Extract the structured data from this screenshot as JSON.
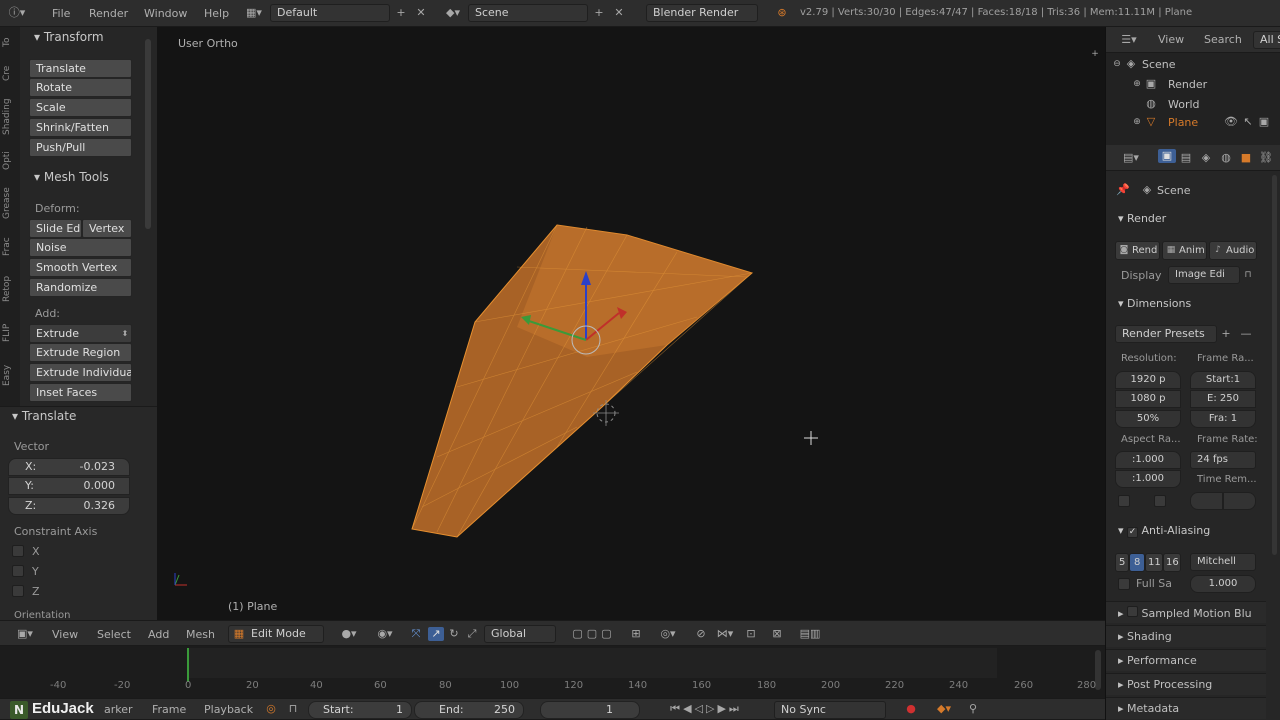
{
  "topbar": {
    "menus": [
      "File",
      "Render",
      "Window",
      "Help"
    ],
    "screen_layout": "Default",
    "scene": "Scene",
    "render_engine": "Blender Render",
    "stats": "v2.79 | Verts:30/30 | Edges:47/47 | Faces:18/18 | Tris:36 | Mem:11.11M | Plane"
  },
  "tool_shelf": {
    "vertical_tabs": [
      "To",
      "Cre",
      "Shading",
      "Opti",
      "Grease",
      "Frac",
      "Retop",
      "FLIP",
      "Easy"
    ],
    "transform": {
      "title": "Transform",
      "buttons": [
        "Translate",
        "Rotate",
        "Scale",
        "Shrink/Fatten",
        "Push/Pull"
      ]
    },
    "mesh_tools": {
      "title": "Mesh Tools",
      "deform_label": "Deform:",
      "slide_edge": "Slide Ed",
      "vertex": "Vertex",
      "buttons": [
        "Noise",
        "Smooth Vertex",
        "Randomize"
      ],
      "add_label": "Add:",
      "extrude": "Extrude",
      "add_buttons": [
        "Extrude Region",
        "Extrude Individual",
        "Inset Faces"
      ]
    },
    "operator": {
      "title": "Translate",
      "vector_label": "Vector",
      "x_label": "X:",
      "x_value": "-0.023",
      "y_label": "Y:",
      "y_value": "0.000",
      "z_label": "Z:",
      "z_value": "0.326",
      "constraint_label": "Constraint Axis",
      "axes": [
        "X",
        "Y",
        "Z"
      ],
      "orientation_label": "Orientation"
    }
  },
  "viewport": {
    "view_name": "User Ortho",
    "object_label": "(1) Plane",
    "header": {
      "view": "View",
      "select": "Select",
      "add": "Add",
      "mesh": "Mesh",
      "mode": "Edit Mode",
      "orientation": "Global"
    }
  },
  "timeline": {
    "ticks": [
      "-40",
      "-20",
      "0",
      "20",
      "40",
      "60",
      "80",
      "100",
      "120",
      "140",
      "160",
      "180",
      "200",
      "220",
      "240",
      "260",
      "280"
    ],
    "menus": [
      "arker",
      "Frame",
      "Playback"
    ],
    "start_label": "Start:",
    "start_value": "1",
    "end_label": "End:",
    "end_value": "250",
    "current_frame": "1",
    "sync": "No Sync",
    "logo": "EduJack"
  },
  "outliner": {
    "view": "View",
    "search": "Search",
    "filter": "All S",
    "items": [
      "Scene",
      "Render",
      "World",
      "Plane"
    ]
  },
  "properties": {
    "scene_label": "Scene",
    "render": {
      "title": "Render",
      "buttons": [
        "Rend",
        "Anim",
        "Audio"
      ],
      "display_label": "Display",
      "display_value": "Image Edi"
    },
    "dimensions": {
      "title": "Dimensions",
      "presets": "Render Presets",
      "resolution_label": "Resolution:",
      "res_x": "1920 p",
      "res_y": "1080 p",
      "res_pct": "50%",
      "frame_range_label": "Frame Ra...",
      "start": "Start:1",
      "end": "E: 250",
      "frame_step": "Fra:  1",
      "aspect_label": "Aspect Ra...",
      "aspect_x": ":1.000",
      "aspect_y": ":1.000",
      "frame_rate_label": "Frame Rate:",
      "fps": "24 fps",
      "time_remap_label": "Time Rem..."
    },
    "anti_aliasing": {
      "title": "Anti-Aliasing",
      "samples": [
        "5",
        "8",
        "11",
        "16"
      ],
      "filter": "Mitchell",
      "full_sample": "Full Sa",
      "size": "1.000"
    },
    "collapsed_panels": [
      "Sampled Motion Blu",
      "Shading",
      "Performance",
      "Post Processing",
      "Metadata"
    ]
  },
  "colors": {
    "mesh_fill": "#b86a28",
    "mesh_edge": "#e8902f",
    "axis_x": "#c0302a",
    "axis_y": "#3a9a3a",
    "axis_z": "#2a40c8",
    "highlight_tab": "#3d5f95"
  }
}
